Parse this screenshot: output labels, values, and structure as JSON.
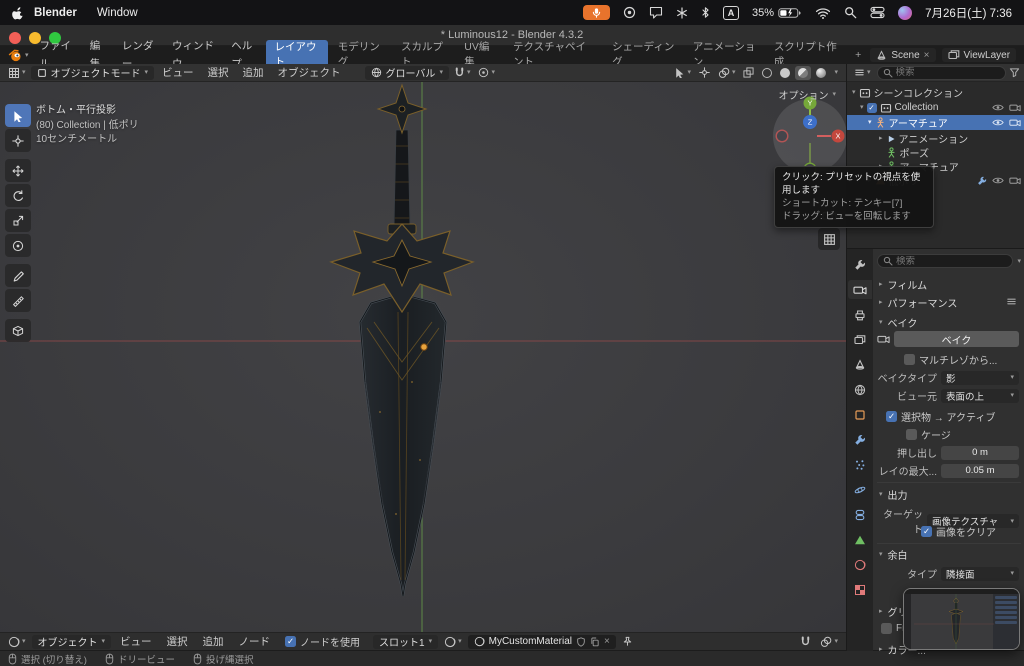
{
  "colors": {
    "accent_blue": "#4772b3",
    "record_orange": "#e8732c",
    "axis_x_red": "#8a4848",
    "axis_y_green": "#5f8a48",
    "origin_orange": "#e8a33d",
    "gold_trim": "#7a5f2a"
  },
  "menubar": {
    "app": "Blender",
    "window_menu": "Window",
    "input_badge": "A",
    "battery": "35%",
    "clock": "7月26日(土) 7:36"
  },
  "titlebar": {
    "title": "* Luminous12 - Blender 4.3.2"
  },
  "topbar": {
    "menus": [
      "ファイル",
      "編集",
      "レンダー",
      "ウィンドウ",
      "ヘルプ"
    ],
    "workspaces": [
      "レイアウト",
      "モデリング",
      "スカルプト",
      "UV編集",
      "テクスチャペイント",
      "シェーディング",
      "アニメーション",
      "スクリプト作成"
    ],
    "add_workspace": "+",
    "scene": "Scene",
    "viewlayer": "ViewLayer"
  },
  "viewport_header": {
    "mode": "オブジェクトモード",
    "menus": [
      "ビュー",
      "選択",
      "追加",
      "オブジェクト"
    ],
    "orientation": "グローバル"
  },
  "viewport": {
    "info": [
      "ボトム・平行投影",
      "(80) Collection | 低ポリ",
      "10センチメートル"
    ],
    "options": "オプション",
    "axis_x": "X",
    "axis_y": "Y",
    "axis_z": "Z"
  },
  "tooltip": {
    "lines": [
      "クリック: プリセットの視点を使用します",
      "ショートカット: テンキー[7]",
      "ドラッグ: ビューを回転します"
    ]
  },
  "outliner": {
    "search_placeholder": "検索",
    "rows": [
      {
        "label": "シーンコレクション"
      },
      {
        "label": "Collection"
      },
      {
        "label": "アーマチュア"
      },
      {
        "label": "アニメーション"
      },
      {
        "label": "ポーズ"
      },
      {
        "label": "アーマチュア"
      },
      {
        "label": "低ポリ"
      }
    ]
  },
  "properties": {
    "search_placeholder": "検索",
    "sections": {
      "film": "フィルム",
      "performance": "パフォーマンス",
      "bake": "ベイク",
      "output": "出力",
      "margin": "余白",
      "grease_pencil": "グリ...",
      "freestyle": "Fre...",
      "color_management": "カラー..."
    },
    "bake_button": "ベイク",
    "fields": {
      "multires": "マルチレゾから...",
      "bake_type_label": "ベイクタイプ",
      "bake_type_value": "影",
      "view_from_label": "ビュー元",
      "view_from_value": "表面の上",
      "selected_to_active": "選択物 → アクティブ",
      "cage": "ケージ",
      "extrusion_label": "押し出し",
      "extrusion_value": "0 m",
      "ray_distance_label": "レイの最大...",
      "ray_distance_value": "0.05 m",
      "target_label": "ターゲット",
      "target_value": "画像テクスチャ",
      "clear_image": "画像をクリア",
      "margin_type_label": "タイプ",
      "margin_type_value": "隣接面"
    }
  },
  "shader_header": {
    "type": "オブジェクト",
    "menus": [
      "ビュー",
      "選択",
      "追加",
      "ノード"
    ],
    "use_nodes": "ノードを使用",
    "slot": "スロット1",
    "material": "MyCustomMaterial"
  },
  "statusbar": {
    "items": [
      "選択 (切り替え)",
      "ドリービュー",
      "投げ縄選択"
    ]
  }
}
